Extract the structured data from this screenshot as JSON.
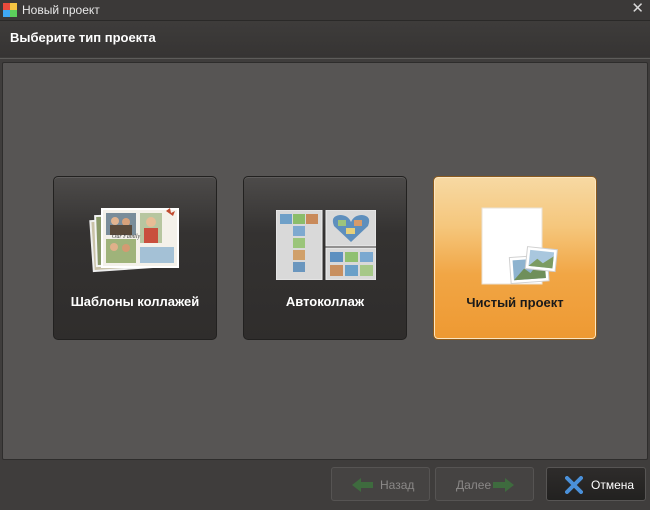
{
  "window": {
    "title": "Новый проект",
    "close_glyph": "✕"
  },
  "header": {
    "title": "Выберите тип проекта"
  },
  "project_types": [
    {
      "label": "Шаблоны коллажей",
      "icon": "collage-templates-icon",
      "selected": false
    },
    {
      "label": "Автоколлаж",
      "icon": "auto-collage-icon",
      "selected": false
    },
    {
      "label": "Чистый проект",
      "icon": "blank-project-icon",
      "selected": true
    }
  ],
  "collage_preview_text": "Our Family",
  "footer": {
    "back_label": "Назад",
    "next_label": "Далее",
    "cancel_label": "Отмена",
    "back_enabled": false,
    "next_enabled": false
  },
  "colors": {
    "background": "#3f3d3c",
    "panel": "#575554",
    "selected_card": "#f1a645",
    "arrow_disabled": "#3e6b3e",
    "cancel_icon": "#4a90d9"
  }
}
